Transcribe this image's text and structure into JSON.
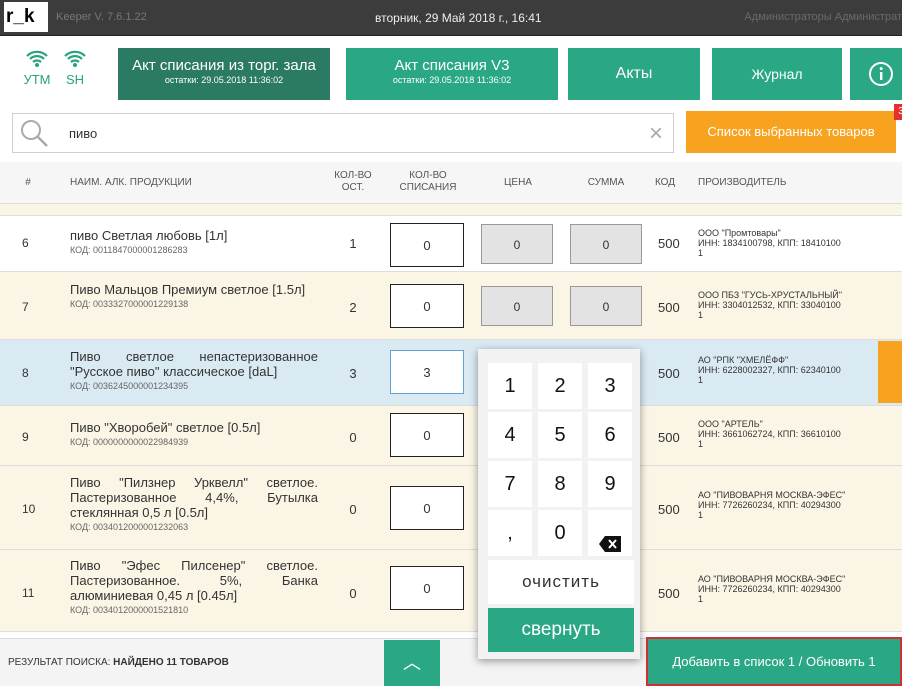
{
  "app": {
    "logo": "r_k",
    "version": "Keeper V. 7.6.1.22",
    "datetime": "вторник, 29 Май 2018 г., 16:41",
    "user": "Администраторы Администрат"
  },
  "status": {
    "utm": "УТМ",
    "sh": "SH"
  },
  "nav": [
    {
      "title": "Акт списания из торг. зала",
      "sub": "остатки: 29.05.2018 11:36:02"
    },
    {
      "title": "Акт списания V3",
      "sub": "остатки: 29.05.2018 11:36:02"
    },
    {
      "title": "Акты"
    },
    {
      "title": "Журнал"
    }
  ],
  "search": {
    "query": "пиво"
  },
  "selected_btn": "Список выбранных товаров",
  "selected_count": "3",
  "columns": {
    "num": "#",
    "name": "НАИМ. АЛК. ПРОДУКЦИИ",
    "stock": "КОЛ-ВО ОСТ.",
    "qty": "КОЛ-ВО СПИСАНИЯ",
    "price": "ЦЕНА",
    "sum": "СУММА",
    "code": "КОД",
    "maker": "ПРОИЗВОДИТЕЛЬ"
  },
  "rows": [
    {
      "n": "6",
      "name": "пиво Светлая любовь  [1л]",
      "code": "КОД: 0011847000001286283",
      "stock": "1",
      "qty": "0",
      "price": "0",
      "sum": "0",
      "kod": "500",
      "maker": "ООО \"Промтовары\"",
      "inn": "ИНН: 1834100798, КПП: 18410100",
      "extra": "1"
    },
    {
      "n": "7",
      "name": "Пиво Мальцов Премиум светлое  [1.5л]",
      "code": "КОД: 0033327000001229138",
      "stock": "2",
      "qty": "0",
      "price": "0",
      "sum": "0",
      "kod": "500",
      "maker": "ООО ПБЗ \"ГУСЬ-ХРУСТАЛЬНЫЙ\"",
      "inn": "ИНН: 3304012532, КПП: 33040100",
      "extra": "1"
    },
    {
      "n": "8",
      "name": "Пиво светлое непастеризованное \"Русское пиво\" классическое  [daL]",
      "code": "КОД: 0036245000001234395",
      "stock": "3",
      "qty": "3",
      "kod": "500",
      "maker": "АО \"РПК \"ХМЕЛЁФФ\"",
      "inn": "ИНН: 6228002327, КПП: 62340100",
      "extra": "1"
    },
    {
      "n": "9",
      "name": "Пиво \"Хворобей\" светлое  [0.5л]",
      "code": "КОД: 0000000000022984939",
      "stock": "0",
      "qty": "0",
      "kod": "500",
      "maker": "ООО \"АРТЕЛЬ\"",
      "inn": "ИНН: 3661062724, КПП: 36610100",
      "extra": "1"
    },
    {
      "n": "10",
      "name": "Пиво \"Пилзнер Урквелл\" светлое. Пастеризованное 4,4%, Бутылка стеклянная 0,5 л  [0.5л]",
      "code": "КОД: 0034012000001232063",
      "stock": "0",
      "qty": "0",
      "kod": "500",
      "maker": "АО \"ПИВОВАРНЯ МОСКВА-ЭФЕС\"",
      "inn": "ИНН: 7726260234, КПП: 40294300",
      "extra": "1"
    },
    {
      "n": "11",
      "name": "Пиво \"Эфес Пилсенер\" светлое. Пастеризованное. 5%, Банка алюминиевая 0,45 л  [0.45л]",
      "code": "КОД: 0034012000001521810",
      "stock": "0",
      "qty": "0",
      "kod": "500",
      "maker": "АО \"ПИВОВАРНЯ МОСКВА-ЭФЕС\"",
      "inn": "ИНН: 7726260234, КПП: 40294300",
      "extra": "1"
    }
  ],
  "numpad": {
    "keys": [
      "1",
      "2",
      "3",
      "4",
      "5",
      "6",
      "7",
      "8",
      "9",
      ",",
      "0"
    ],
    "backspace": "backspace-icon",
    "clear": "очистить",
    "collapse": "свернуть"
  },
  "footer": {
    "result_label": "РЕЗУЛЬТАТ ПОИСКА: ",
    "result_value": "НАЙДЕНО 11 ТОВАРОВ",
    "add_button": "Добавить в список 1 / Обновить 1"
  },
  "colors": {
    "accent": "#2aa886",
    "orange": "#f8a31f",
    "selected_row": "#daeaf3"
  }
}
